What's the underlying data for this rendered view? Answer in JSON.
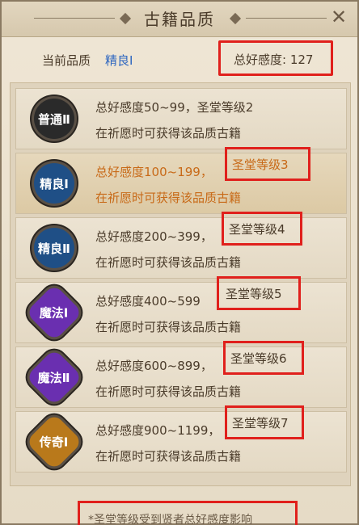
{
  "window": {
    "title": "古籍品质",
    "close_icon": "close-icon"
  },
  "current": {
    "label": "当前品质",
    "value": "精良Ⅰ"
  },
  "favor": {
    "text": "总好感度: 127"
  },
  "tiers": [
    {
      "badge": "普通Ⅱ",
      "range": "总好感度50~99，",
      "level": "圣堂等级2",
      "desc": "在祈愿时可获得该品质古籍",
      "badge_color": "#2a2a2a",
      "shape": "circle",
      "highlight": false,
      "active": false
    },
    {
      "badge": "精良Ⅰ",
      "range": "总好感度100~199，",
      "level": "圣堂等级3",
      "desc": "在祈愿时可获得该品质古籍",
      "badge_color": "#1f4f86",
      "shape": "circle",
      "highlight": true,
      "active": true
    },
    {
      "badge": "精良Ⅱ",
      "range": "总好感度200~399，",
      "level": "圣堂等级4",
      "desc": "在祈愿时可获得该品质古籍",
      "badge_color": "#1f4f86",
      "shape": "circle",
      "highlight": true,
      "active": false
    },
    {
      "badge": "魔法Ⅰ",
      "range": "总好感度400~599",
      "level": "圣堂等级5",
      "desc": "在祈愿时可获得该品质古籍",
      "badge_color": "#6a2fb0",
      "shape": "oct",
      "highlight": true,
      "active": false
    },
    {
      "badge": "魔法Ⅱ",
      "range": "总好感度600~899，",
      "level": "圣堂等级6",
      "desc": "在祈愿时可获得该品质古籍",
      "badge_color": "#6a2fb0",
      "shape": "oct",
      "highlight": true,
      "active": false
    },
    {
      "badge": "传奇Ⅰ",
      "range": "总好感度900~1199，",
      "level": "圣堂等级7",
      "desc": "在祈愿时可获得该品质古籍",
      "badge_color": "#b9791b",
      "shape": "oct",
      "highlight": true,
      "active": false
    }
  ],
  "footer": {
    "note": "*圣堂等级受到贤者总好感度影响"
  },
  "colors": {
    "highlight": "#e0201c",
    "current_quality": "#2d66c0",
    "active_text": "#c86a18"
  }
}
